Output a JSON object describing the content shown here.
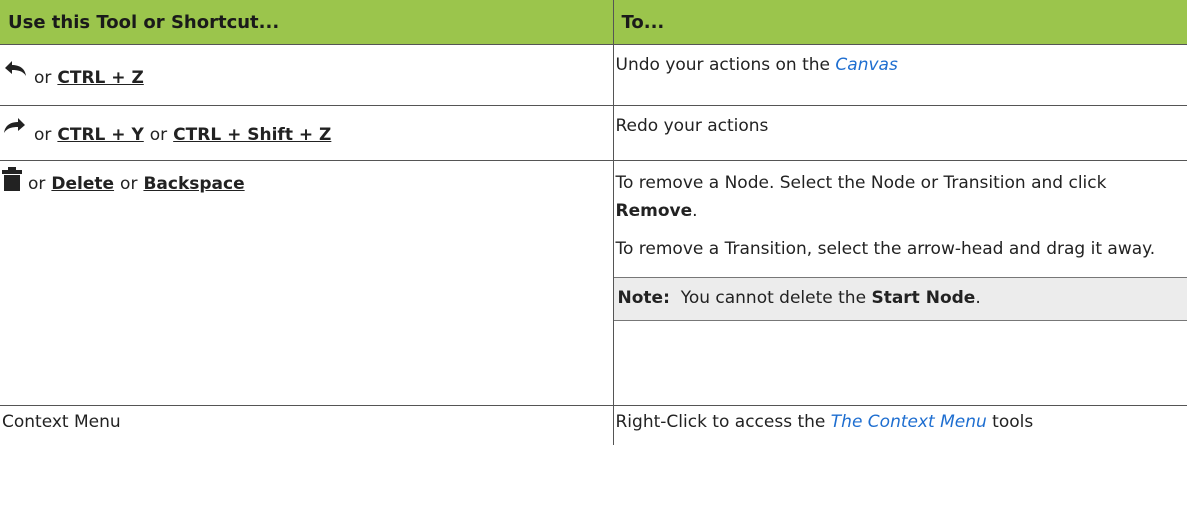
{
  "header": {
    "col1": "Use this Tool or Shortcut...",
    "col2": "To..."
  },
  "rows": [
    {
      "icon": "undo-arrow-icon",
      "connector": "or",
      "shortcut1": "CTRL + Z",
      "desc_prefix": "Undo your actions on the ",
      "desc_link": "Canvas"
    },
    {
      "icon": "redo-arrow-icon",
      "connector1": "or",
      "shortcut1": "CTRL + Y",
      "connector2": "or",
      "shortcut2": "CTRL + Shift + Z",
      "desc": "Redo your actions"
    },
    {
      "icon": "trash-icon",
      "connector1": "or",
      "shortcut1": "Delete",
      "connector2": "or",
      "shortcut2": "Backspace",
      "desc1_prefix": "To remove a Node. Select the Node or Transition and click ",
      "desc1_bold": "Remove",
      "desc1_suffix": ".",
      "desc2": "To remove a Transition, select the arrow-head and drag it away.",
      "note_label": "Note:",
      "note_prefix": "You cannot delete the ",
      "note_bold": "Start Node",
      "note_suffix": "."
    },
    {
      "tool": "Context Menu",
      "desc_prefix": "Right-Click to access the ",
      "desc_link": "The Context Menu",
      "desc_suffix": " tools"
    }
  ]
}
